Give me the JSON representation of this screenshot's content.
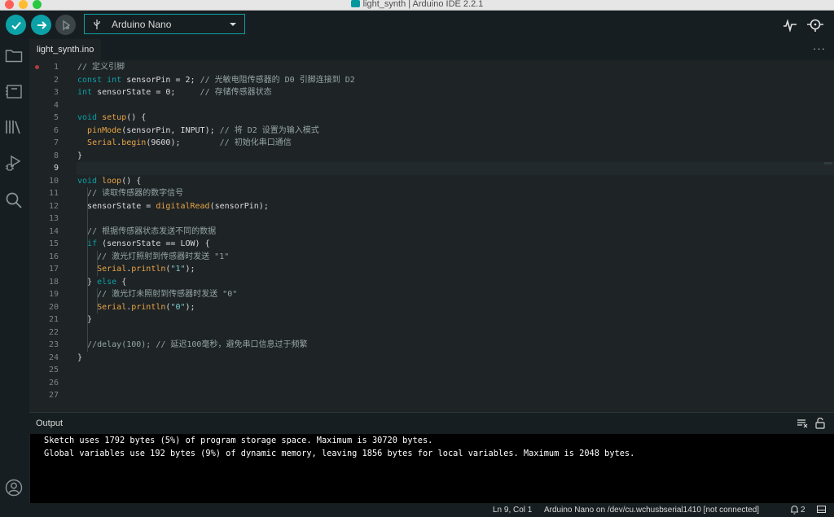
{
  "window": {
    "title": "light_synth | Arduino IDE 2.2.1"
  },
  "toolbar": {
    "verify_icon": "checkmark-icon",
    "upload_icon": "arrow-right-icon",
    "debug_icon": "debug-icon",
    "board_name": "Arduino Nano",
    "board_icon": "usb-icon",
    "serial_plotter_icon": "serial-plotter-icon",
    "serial_monitor_icon": "serial-monitor-icon"
  },
  "sidebar": {
    "items": [
      {
        "icon": "folder-icon"
      },
      {
        "icon": "board-manager-icon"
      },
      {
        "icon": "library-icon"
      },
      {
        "icon": "debug-sidebar-icon"
      },
      {
        "icon": "search-icon"
      }
    ],
    "account_icon": "account-icon"
  },
  "tabs": [
    {
      "label": "light_synth.ino",
      "active": true
    }
  ],
  "tab_more": "···",
  "editor": {
    "active_line": 9,
    "breakpoint_line": 1,
    "lines": [
      {
        "n": "1",
        "code": "// 定义引脚"
      },
      {
        "n": "2",
        "code": "const int sensorPin = 2; // 光敏电阻传感器的 D0 引脚连接到 D2"
      },
      {
        "n": "3",
        "code": "int sensorState = 0;     // 存储传感器状态"
      },
      {
        "n": "4",
        "code": ""
      },
      {
        "n": "5",
        "code": "void setup() {"
      },
      {
        "n": "6",
        "code": "  pinMode(sensorPin, INPUT); // 将 D2 设置为输入模式"
      },
      {
        "n": "7",
        "code": "  Serial.begin(9600);        // 初始化串口通信"
      },
      {
        "n": "8",
        "code": "}"
      },
      {
        "n": "9",
        "code": ""
      },
      {
        "n": "10",
        "code": "void loop() {"
      },
      {
        "n": "11",
        "code": "  // 读取传感器的数字信号"
      },
      {
        "n": "12",
        "code": "  sensorState = digitalRead(sensorPin);"
      },
      {
        "n": "13",
        "code": ""
      },
      {
        "n": "14",
        "code": "  // 根据传感器状态发送不同的数据"
      },
      {
        "n": "15",
        "code": "  if (sensorState == LOW) {"
      },
      {
        "n": "16",
        "code": "    // 激光灯照射到传感器时发送 \"1\""
      },
      {
        "n": "17",
        "code": "    Serial.println(\"1\");"
      },
      {
        "n": "18",
        "code": "  } else {"
      },
      {
        "n": "19",
        "code": "    // 激光灯未照射到传感器时发送 \"0\""
      },
      {
        "n": "20",
        "code": "    Serial.println(\"0\");"
      },
      {
        "n": "21",
        "code": "  }"
      },
      {
        "n": "22",
        "code": ""
      },
      {
        "n": "23",
        "code": "  //delay(100); // 延迟100毫秒，避免串口信息过于频繁"
      },
      {
        "n": "24",
        "code": "}"
      },
      {
        "n": "25",
        "code": ""
      },
      {
        "n": "26",
        "code": ""
      },
      {
        "n": "27",
        "code": ""
      }
    ]
  },
  "output": {
    "label": "Output",
    "clear_icon": "clear-output-icon",
    "lock_icon": "scroll-lock-icon",
    "lines": [
      "Sketch uses 1792 bytes (5%) of program storage space. Maximum is 30720 bytes.",
      "Global variables use 192 bytes (9%) of dynamic memory, leaving 1856 bytes for local variables. Maximum is 2048 bytes."
    ]
  },
  "status": {
    "cursor": "Ln 9, Col 1",
    "board_port": "Arduino Nano on /dev/cu.wchusbserial1410 [not connected]",
    "notifications_icon": "bell-icon",
    "notifications_count": "2",
    "panel_icon": "toggle-panel-icon"
  },
  "colors": {
    "accent": "#0ca1a6",
    "keyword": "#0ca1a6",
    "function": "#e9a445",
    "comment": "#95a5a6",
    "background": "#1e2326"
  }
}
